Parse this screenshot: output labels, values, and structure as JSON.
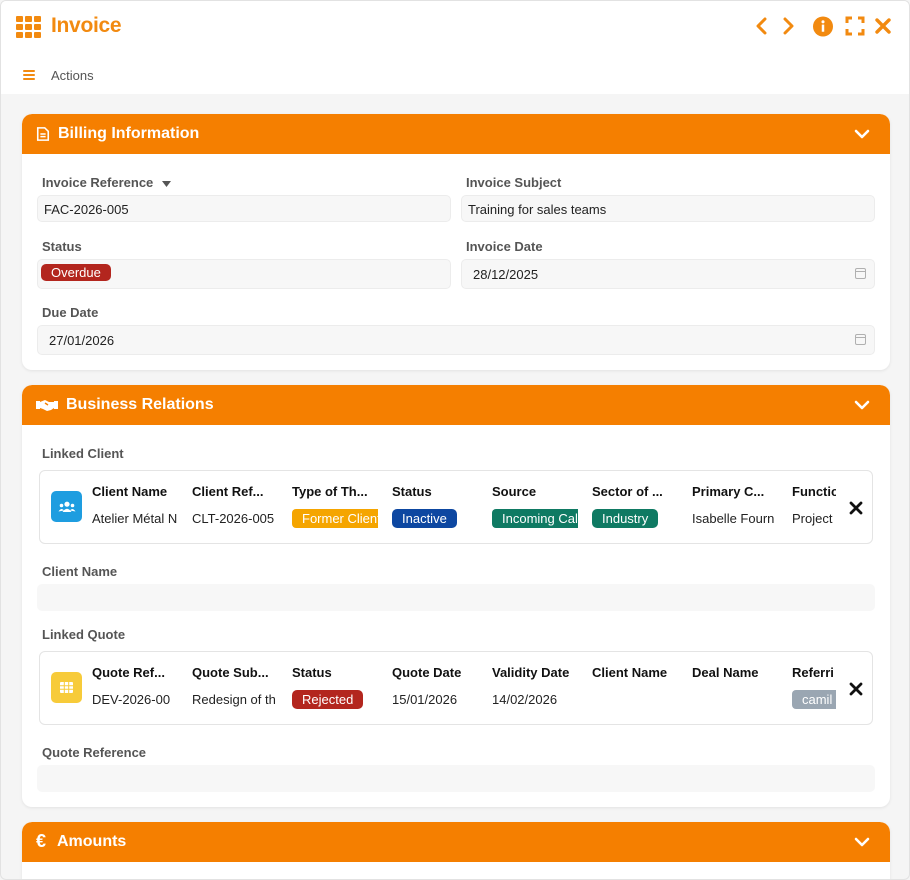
{
  "window": {
    "title": "Invoice"
  },
  "actions_label": "Actions",
  "billing": {
    "header": "Billing Information",
    "invoice_reference": {
      "label": "Invoice Reference",
      "value": "FAC-2026-005"
    },
    "invoice_subject": {
      "label": "Invoice Subject",
      "value": "Training for sales teams"
    },
    "status": {
      "label": "Status",
      "value": "Overdue",
      "color": "#b3261e"
    },
    "invoice_date": {
      "label": "Invoice Date",
      "value": "28/12/2025"
    },
    "due_date": {
      "label": "Due Date",
      "value": "27/01/2026"
    }
  },
  "relations": {
    "header": "Business Relations",
    "linked_client_label": "Linked Client",
    "client_columns": [
      "Client Name",
      "Client Ref...",
      "Type of Th...",
      "Status",
      "Source",
      "Sector of ...",
      "Primary C...",
      "Functio"
    ],
    "client_row": {
      "client_name": "Atelier Métal N",
      "client_ref": "CLT-2026-005",
      "type": {
        "text": "Former Client",
        "color": "#f5a500"
      },
      "status": {
        "text": "Inactive",
        "color": "#0d47a1"
      },
      "source": {
        "text": "Incoming Call",
        "color": "#0f7a63"
      },
      "sector": {
        "text": "Industry",
        "color": "#0f7a63"
      },
      "primary_contact": "Isabelle Fourn",
      "function": "Project"
    },
    "client_name_label": "Client Name",
    "linked_quote_label": "Linked Quote",
    "quote_columns": [
      "Quote Ref...",
      "Quote Sub...",
      "Status",
      "Quote Date",
      "Validity Date",
      "Client Name",
      "Deal Name",
      "Referri"
    ],
    "quote_row": {
      "quote_ref": "DEV-2026-00",
      "quote_subject": "Redesign of th",
      "status": {
        "text": "Rejected",
        "color": "#b3261e"
      },
      "quote_date": "15/01/2026",
      "validity_date": "14/02/2026",
      "referrer": {
        "text": "camil",
        "color": "#9aa6b2"
      }
    },
    "quote_reference_label": "Quote Reference"
  },
  "amounts": {
    "header": "Amounts"
  },
  "colors": {
    "accent": "#f57f00",
    "client_icon_bg": "#1e9de0",
    "quote_icon_bg": "#f7cb3a"
  }
}
